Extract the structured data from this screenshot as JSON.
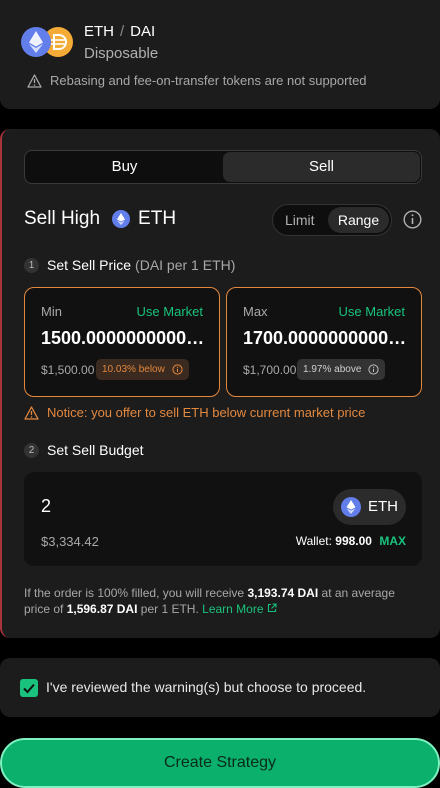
{
  "pair": {
    "base": "ETH",
    "separator": "/",
    "quote": "DAI",
    "strategy_type": "Disposable",
    "warning": "Rebasing and fee-on-transfer tokens are not supported"
  },
  "toggle": {
    "buy_label": "Buy",
    "sell_label": "Sell",
    "selected": "Sell"
  },
  "sell": {
    "title": "Sell High",
    "token": "ETH",
    "mode": {
      "limit_label": "Limit",
      "range_label": "Range",
      "selected": "Range"
    }
  },
  "step1": {
    "num": "1",
    "title": "Set Sell Price",
    "unit": "(DAI per 1 ETH)"
  },
  "min": {
    "label": "Min",
    "use_market": "Use Market",
    "value": "1500.000000000000000000",
    "fiat": "$1,500.00",
    "badge": "10.03% below"
  },
  "max": {
    "label": "Max",
    "use_market": "Use Market",
    "value": "1700.000000000000000000",
    "fiat": "$1,700.00",
    "badge": "1.97% above"
  },
  "notice": "Notice: you offer to sell ETH below current market price",
  "step2": {
    "num": "2",
    "title": "Set Sell Budget"
  },
  "budget": {
    "amount": "2",
    "fiat": "$3,334.42",
    "token": "ETH",
    "wallet_label": "Wallet:",
    "wallet_value": "998.00",
    "max_label": "MAX"
  },
  "summary": {
    "part1": "If the order is 100% filled, you will receive",
    "receive": "3,193.74 DAI",
    "part2": "at an average price of",
    "avg_price": "1,596.87 DAI",
    "part3": "per 1 ETH.",
    "learn_more": "Learn More"
  },
  "ack": {
    "checked": true,
    "label": "I've reviewed the warning(s) but choose to proceed."
  },
  "cta": {
    "label": "Create Strategy"
  },
  "colors": {
    "accent": "#19c37d",
    "warning": "#e3883f",
    "sell_border": "#a6343a",
    "eth": "#627eea",
    "dai": "#f5ac37"
  }
}
